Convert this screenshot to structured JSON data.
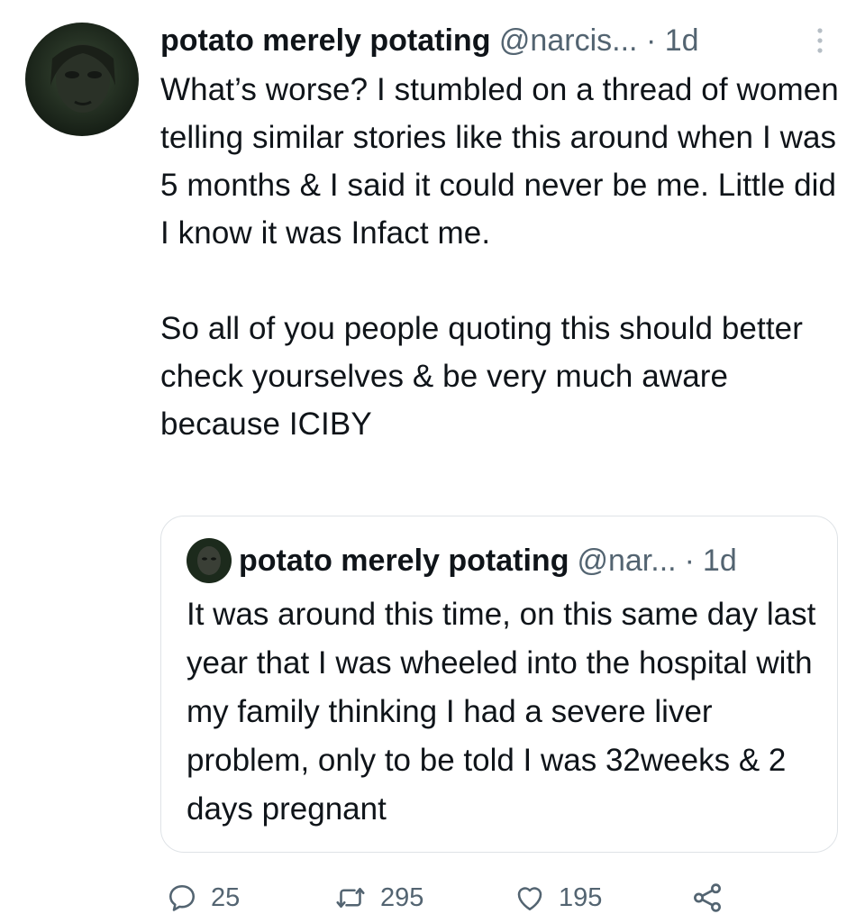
{
  "tweet": {
    "author_name": "potato merely potating",
    "handle": "@narcis...",
    "separator": "·",
    "time": "1d",
    "text": [
      "What’s worse? I stumbled on a thread of women telling similar stories like this around when I was 5 months & I said it could never be me. Little did I know it was Infact me.",
      "So all of you people quoting this should better check yourselves & be very much aware because ICIBY"
    ]
  },
  "quoted_tweet": {
    "author_name": "potato merely potating",
    "handle": "@nar...",
    "separator": "·",
    "time": "1d",
    "text": "It was around this time, on this same day last year that I was wheeled into the hospital with my family thinking I had a severe liver problem, only to be told I was 32weeks & 2 days pregnant"
  },
  "actions": {
    "reply_count": "25",
    "retweet_count": "295",
    "like_count": "195"
  },
  "icons": {
    "more": "more-vertical-icon",
    "reply": "reply-bubble-icon",
    "retweet": "retweet-icon",
    "like": "heart-icon",
    "share": "share-icon"
  },
  "colors": {
    "text_primary": "#0f1419",
    "text_secondary": "#536471",
    "border": "#dfe3e7",
    "avatar_bg": "#1c2a1c"
  }
}
